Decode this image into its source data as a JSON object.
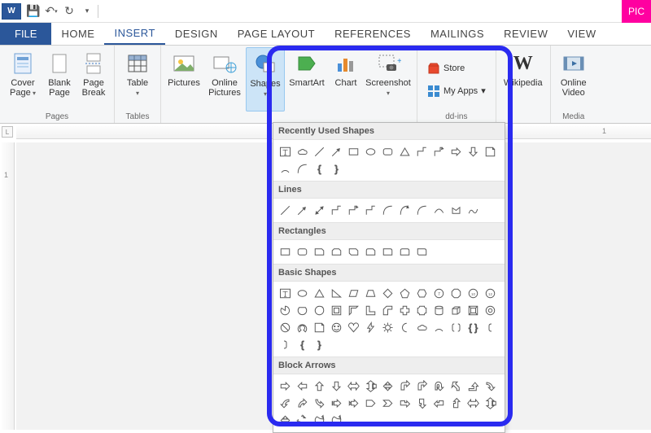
{
  "titlebar": {
    "pic_label": "PIC"
  },
  "tabs": {
    "file": "FILE",
    "list": [
      "HOME",
      "INSERT",
      "DESIGN",
      "PAGE LAYOUT",
      "REFERENCES",
      "MAILINGS",
      "REVIEW",
      "VIEW"
    ],
    "active": "INSERT"
  },
  "ribbon": {
    "groups": {
      "pages": {
        "label": "Pages",
        "cover": "Cover Page",
        "blank": "Blank Page",
        "break": "Page Break"
      },
      "tables": {
        "label": "Tables",
        "table": "Table"
      },
      "illustrations": {
        "pictures": "Pictures",
        "online_pics": "Online Pictures",
        "shapes": "Shapes",
        "smartart": "SmartArt",
        "chart": "Chart",
        "screenshot": "Screenshot"
      },
      "addins": {
        "label": "dd-ins",
        "store": "Store",
        "myapps": "My Apps",
        "wikipedia": "Wikipedia"
      },
      "media": {
        "label": "Media",
        "video": "Online Video"
      }
    }
  },
  "ruler": {
    "corner": "L",
    "h_marks": [
      "1"
    ],
    "v_marks": [
      "1"
    ]
  },
  "shapes_panel": {
    "sections": [
      {
        "title": "Recently Used Shapes",
        "count": 17
      },
      {
        "title": "Lines",
        "count": 12
      },
      {
        "title": "Rectangles",
        "count": 9
      },
      {
        "title": "Basic Shapes",
        "count": 42
      },
      {
        "title": "Block Arrows",
        "count": 30
      }
    ]
  }
}
